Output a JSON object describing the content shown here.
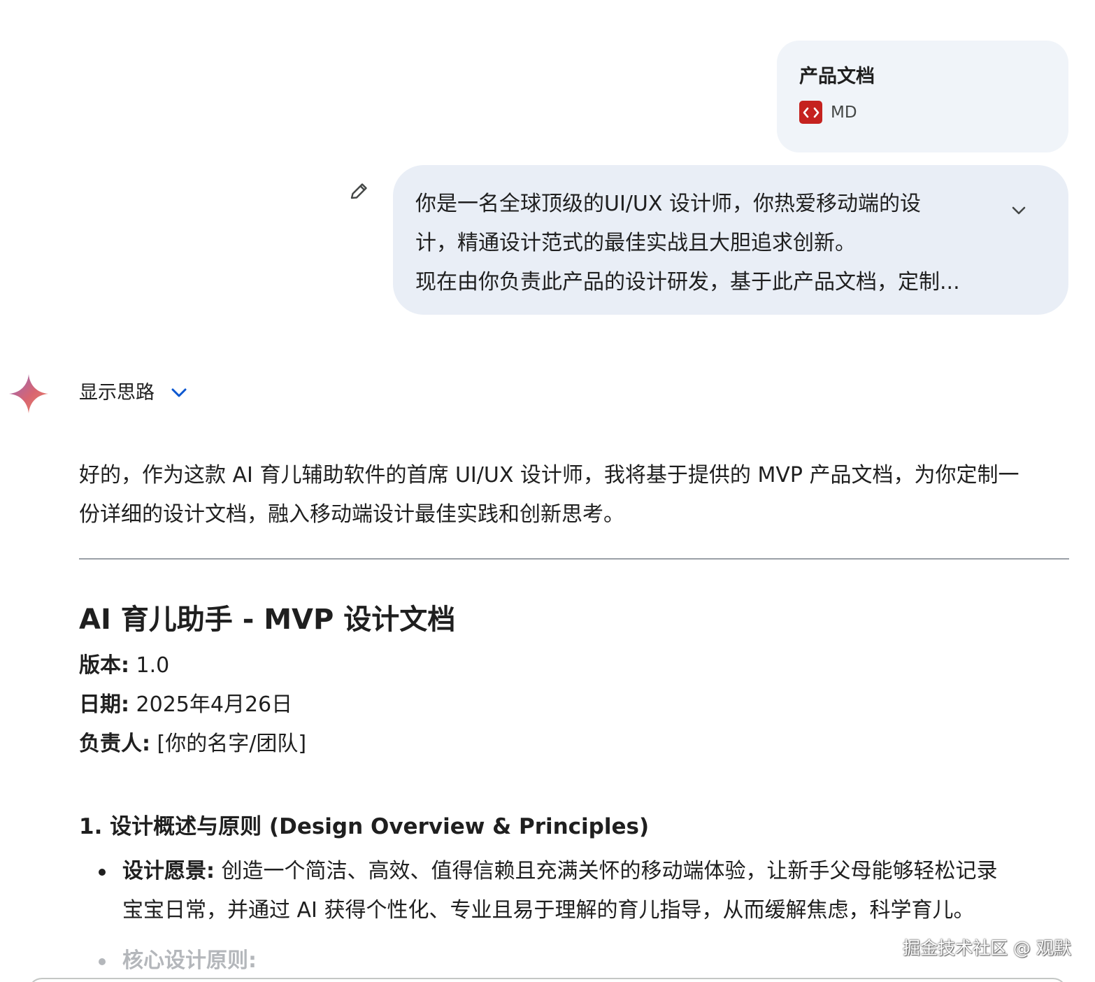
{
  "attachment": {
    "title": "产品文档",
    "file_type": "MD",
    "icon": "code-file-icon",
    "icon_color": "#c5221f"
  },
  "user_message": {
    "lines": [
      "你是一名全球顶级的UI/UX 设计师，你热爱移动端的设",
      "计，精通设计范式的最佳实战且大胆追求创新。",
      "现在由你负责此产品的设计研发，基于此产品文档，定制..."
    ],
    "edit_icon": "pencil-icon",
    "expand_icon": "chevron-down-icon",
    "bubble_color": "#e9eef6"
  },
  "model": {
    "avatar_icon": "gemini-spark-icon",
    "show_thoughts_label": "显示思路",
    "show_thoughts_icon": "chevron-down-icon",
    "accent_color": "#0b57d0"
  },
  "response": {
    "intro_lines": [
      "好的，作为这款 AI 育儿辅助软件的首席 UI/UX 设计师，我将基于提供的 MVP 产品文档，为你定制一",
      "份详细的设计文档，融入移动端设计最佳实践和创新思考。"
    ],
    "doc_title": "AI 育儿助手 - MVP 设计文档",
    "meta": [
      {
        "key": "版本:",
        "value": " 1.0"
      },
      {
        "key": "日期:",
        "value": " 2025年4月26日"
      },
      {
        "key": "负责人:",
        "value": " [你的名字/团队]"
      }
    ],
    "section_heading": "1. 设计概述与原则 (Design Overview & Principles)",
    "bullets": [
      {
        "key": "设计愿景:",
        "lines": [
          " 创造一个简洁、高效、值得信赖且充满关怀的移动端体验，让新手父母能够轻松记录",
          "宝宝日常，并通过 AI 获得个性化、专业且易于理解的育儿指导，从而缓解焦虑，科学育儿。"
        ]
      },
      {
        "key": "核心设计原则:",
        "lines": []
      }
    ]
  },
  "watermark": "掘金技术社区 @ 观默"
}
